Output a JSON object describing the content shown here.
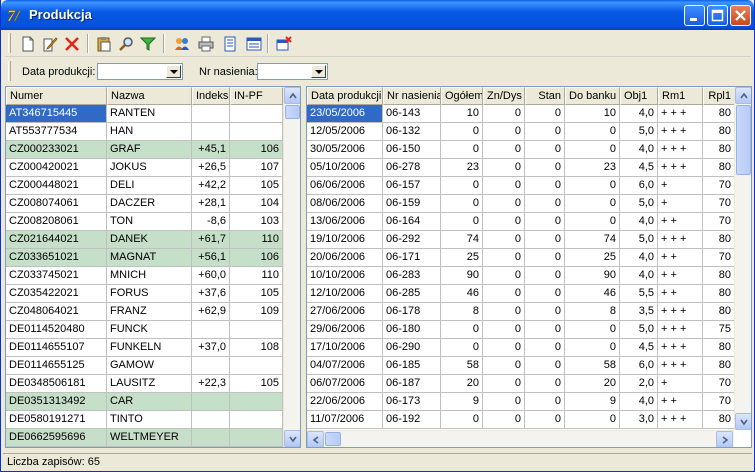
{
  "window": {
    "title": "Produkcja"
  },
  "toolbar": {
    "icons": [
      "new-document-icon",
      "edit-document-icon",
      "delete-icon",
      "paste-icon",
      "search-icon",
      "filter-icon",
      "users-icon",
      "print-icon",
      "print-preview-icon",
      "report-icon",
      "close-tab-icon"
    ]
  },
  "filters": {
    "date_label": "Data produkcji:",
    "date_value": "",
    "number_label": "Nr nasienia:",
    "number_value": ""
  },
  "left_grid": {
    "columns": [
      "Numer",
      "Nazwa",
      "Indeks",
      "IN-PF"
    ],
    "rows": [
      {
        "numer": "AT346715445",
        "nazwa": "RANTEN",
        "indeks": "",
        "inpf": "",
        "hl": false,
        "sel": true
      },
      {
        "numer": "AT553777534",
        "nazwa": "HAN",
        "indeks": "",
        "inpf": "",
        "hl": false
      },
      {
        "numer": "CZ000233021",
        "nazwa": "GRAF",
        "indeks": "+45,1",
        "inpf": "106",
        "hl": true
      },
      {
        "numer": "CZ000420021",
        "nazwa": "JOKUS",
        "indeks": "+26,5",
        "inpf": "107",
        "hl": false
      },
      {
        "numer": "CZ000448021",
        "nazwa": "DELI",
        "indeks": "+42,2",
        "inpf": "105",
        "hl": false
      },
      {
        "numer": "CZ008074061",
        "nazwa": "DACZER",
        "indeks": "+28,1",
        "inpf": "104",
        "hl": false
      },
      {
        "numer": "CZ008208061",
        "nazwa": "TON",
        "indeks": "-8,6",
        "inpf": "103",
        "hl": false
      },
      {
        "numer": "CZ021644021",
        "nazwa": "DANEK",
        "indeks": "+61,7",
        "inpf": "110",
        "hl": true
      },
      {
        "numer": "CZ033651021",
        "nazwa": "MAGNAT",
        "indeks": "+56,1",
        "inpf": "106",
        "hl": true
      },
      {
        "numer": "CZ033745021",
        "nazwa": "MNICH",
        "indeks": "+60,0",
        "inpf": "110",
        "hl": false
      },
      {
        "numer": "CZ035422021",
        "nazwa": "FORUS",
        "indeks": "+37,6",
        "inpf": "105",
        "hl": false
      },
      {
        "numer": "CZ048064021",
        "nazwa": "FRANZ",
        "indeks": "+62,9",
        "inpf": "109",
        "hl": false
      },
      {
        "numer": "DE0114520480",
        "nazwa": "FUNCK",
        "indeks": "",
        "inpf": "",
        "hl": false
      },
      {
        "numer": "DE0114655107",
        "nazwa": "FUNKELN",
        "indeks": "+37,0",
        "inpf": "108",
        "hl": false
      },
      {
        "numer": "DE0114655125",
        "nazwa": "GAMOW",
        "indeks": "",
        "inpf": "",
        "hl": false
      },
      {
        "numer": "DE0348506181",
        "nazwa": "LAUSITZ",
        "indeks": "+22,3",
        "inpf": "105",
        "hl": false
      },
      {
        "numer": "DE0351313492",
        "nazwa": "CAR",
        "indeks": "",
        "inpf": "",
        "hl": true
      },
      {
        "numer": "DE0580191271",
        "nazwa": "TINTO",
        "indeks": "",
        "inpf": "",
        "hl": false
      },
      {
        "numer": "DE0662595696",
        "nazwa": "WELTMEYER",
        "indeks": "",
        "inpf": "",
        "hl": true
      }
    ]
  },
  "right_grid": {
    "columns": [
      "Data produkcji",
      "Nr nasienia",
      "Ogółem",
      "Zn/Dys",
      "Stan",
      "Do banku",
      "Obj1",
      "Rm1",
      "Rpl1"
    ],
    "rows": [
      {
        "data": "23/05/2006",
        "nr": "06-143",
        "ogolem": "10",
        "zn": "0",
        "stan": "0",
        "bank": "10",
        "obj": "4,0",
        "rm": "+ + +",
        "rpl": "80",
        "sel": true
      },
      {
        "data": "12/05/2006",
        "nr": "06-132",
        "ogolem": "0",
        "zn": "0",
        "stan": "0",
        "bank": "0",
        "obj": "5,0",
        "rm": "+ + +",
        "rpl": "80"
      },
      {
        "data": "30/05/2006",
        "nr": "06-150",
        "ogolem": "0",
        "zn": "0",
        "stan": "0",
        "bank": "0",
        "obj": "4,0",
        "rm": "+ + +",
        "rpl": "80"
      },
      {
        "data": "05/10/2006",
        "nr": "06-278",
        "ogolem": "23",
        "zn": "0",
        "stan": "0",
        "bank": "23",
        "obj": "4,5",
        "rm": "+ + +",
        "rpl": "80"
      },
      {
        "data": "06/06/2006",
        "nr": "06-157",
        "ogolem": "0",
        "zn": "0",
        "stan": "0",
        "bank": "0",
        "obj": "6,0",
        "rm": "+",
        "rpl": "70"
      },
      {
        "data": "08/06/2006",
        "nr": "06-159",
        "ogolem": "0",
        "zn": "0",
        "stan": "0",
        "bank": "0",
        "obj": "5,0",
        "rm": "+",
        "rpl": "70"
      },
      {
        "data": "13/06/2006",
        "nr": "06-164",
        "ogolem": "0",
        "zn": "0",
        "stan": "0",
        "bank": "0",
        "obj": "4,0",
        "rm": "+ +",
        "rpl": "70"
      },
      {
        "data": "19/10/2006",
        "nr": "06-292",
        "ogolem": "74",
        "zn": "0",
        "stan": "0",
        "bank": "74",
        "obj": "5,0",
        "rm": "+ + +",
        "rpl": "80"
      },
      {
        "data": "20/06/2006",
        "nr": "06-171",
        "ogolem": "25",
        "zn": "0",
        "stan": "0",
        "bank": "25",
        "obj": "4,0",
        "rm": "+ +",
        "rpl": "70"
      },
      {
        "data": "10/10/2006",
        "nr": "06-283",
        "ogolem": "90",
        "zn": "0",
        "stan": "0",
        "bank": "90",
        "obj": "4,0",
        "rm": "+ +",
        "rpl": "80"
      },
      {
        "data": "12/10/2006",
        "nr": "06-285",
        "ogolem": "46",
        "zn": "0",
        "stan": "0",
        "bank": "46",
        "obj": "5,5",
        "rm": "+ +",
        "rpl": "80"
      },
      {
        "data": "27/06/2006",
        "nr": "06-178",
        "ogolem": "8",
        "zn": "0",
        "stan": "0",
        "bank": "8",
        "obj": "3,5",
        "rm": "+ + +",
        "rpl": "80"
      },
      {
        "data": "29/06/2006",
        "nr": "06-180",
        "ogolem": "0",
        "zn": "0",
        "stan": "0",
        "bank": "0",
        "obj": "5,0",
        "rm": "+ + +",
        "rpl": "75"
      },
      {
        "data": "17/10/2006",
        "nr": "06-290",
        "ogolem": "0",
        "zn": "0",
        "stan": "0",
        "bank": "0",
        "obj": "4,5",
        "rm": "+ + +",
        "rpl": "80"
      },
      {
        "data": "04/07/2006",
        "nr": "06-185",
        "ogolem": "58",
        "zn": "0",
        "stan": "0",
        "bank": "58",
        "obj": "6,0",
        "rm": "+ + +",
        "rpl": "80"
      },
      {
        "data": "06/07/2006",
        "nr": "06-187",
        "ogolem": "20",
        "zn": "0",
        "stan": "0",
        "bank": "20",
        "obj": "2,0",
        "rm": "+",
        "rpl": "70"
      },
      {
        "data": "22/06/2006",
        "nr": "06-173",
        "ogolem": "9",
        "zn": "0",
        "stan": "0",
        "bank": "9",
        "obj": "4,0",
        "rm": "+ +",
        "rpl": "70"
      },
      {
        "data": "11/07/2006",
        "nr": "06-192",
        "ogolem": "0",
        "zn": "0",
        "stan": "0",
        "bank": "0",
        "obj": "3,0",
        "rm": "+ + +",
        "rpl": "80"
      }
    ]
  },
  "status": {
    "text": "Liczba zapisów: 65"
  },
  "colors": {
    "selection": "#316ac5",
    "highlight_row": "#c5dfc8",
    "title_bar": "#0553d9"
  }
}
